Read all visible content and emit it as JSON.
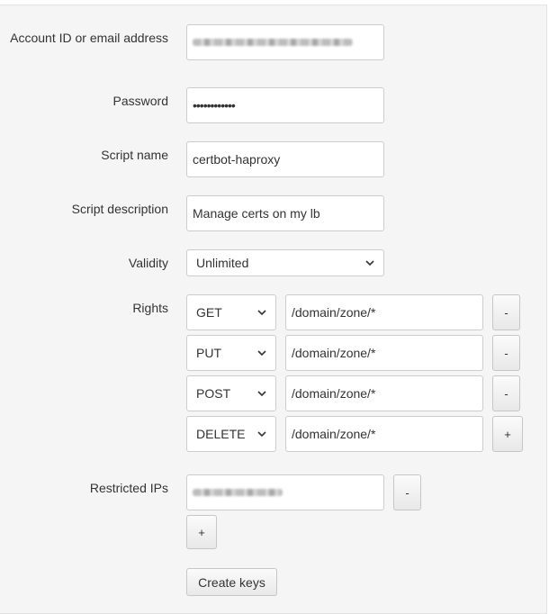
{
  "form": {
    "account": {
      "label": "Account ID or email address",
      "value_redacted": true
    },
    "password": {
      "label": "Password",
      "masked_value": "••••••••••••"
    },
    "script_name": {
      "label": "Script name",
      "value": "certbot-haproxy"
    },
    "script_description": {
      "label": "Script description",
      "value": "Manage certs on my lb"
    },
    "validity": {
      "label": "Validity",
      "selected": "Unlimited"
    },
    "rights": {
      "label": "Rights",
      "rows": [
        {
          "method": "GET",
          "path": "/domain/zone/*",
          "action": "-"
        },
        {
          "method": "PUT",
          "path": "/domain/zone/*",
          "action": "-"
        },
        {
          "method": "POST",
          "path": "/domain/zone/*",
          "action": "-"
        },
        {
          "method": "DELETE",
          "path": "/domain/zone/*",
          "action": "+"
        }
      ]
    },
    "restricted_ips": {
      "label": "Restricted IPs",
      "value_redacted": true,
      "remove_label": "-",
      "add_label": "+"
    },
    "submit_label": "Create keys"
  },
  "colors": {
    "panel_bg": "#f5f5f5",
    "input_border": "#cccccc",
    "text": "#333333"
  }
}
